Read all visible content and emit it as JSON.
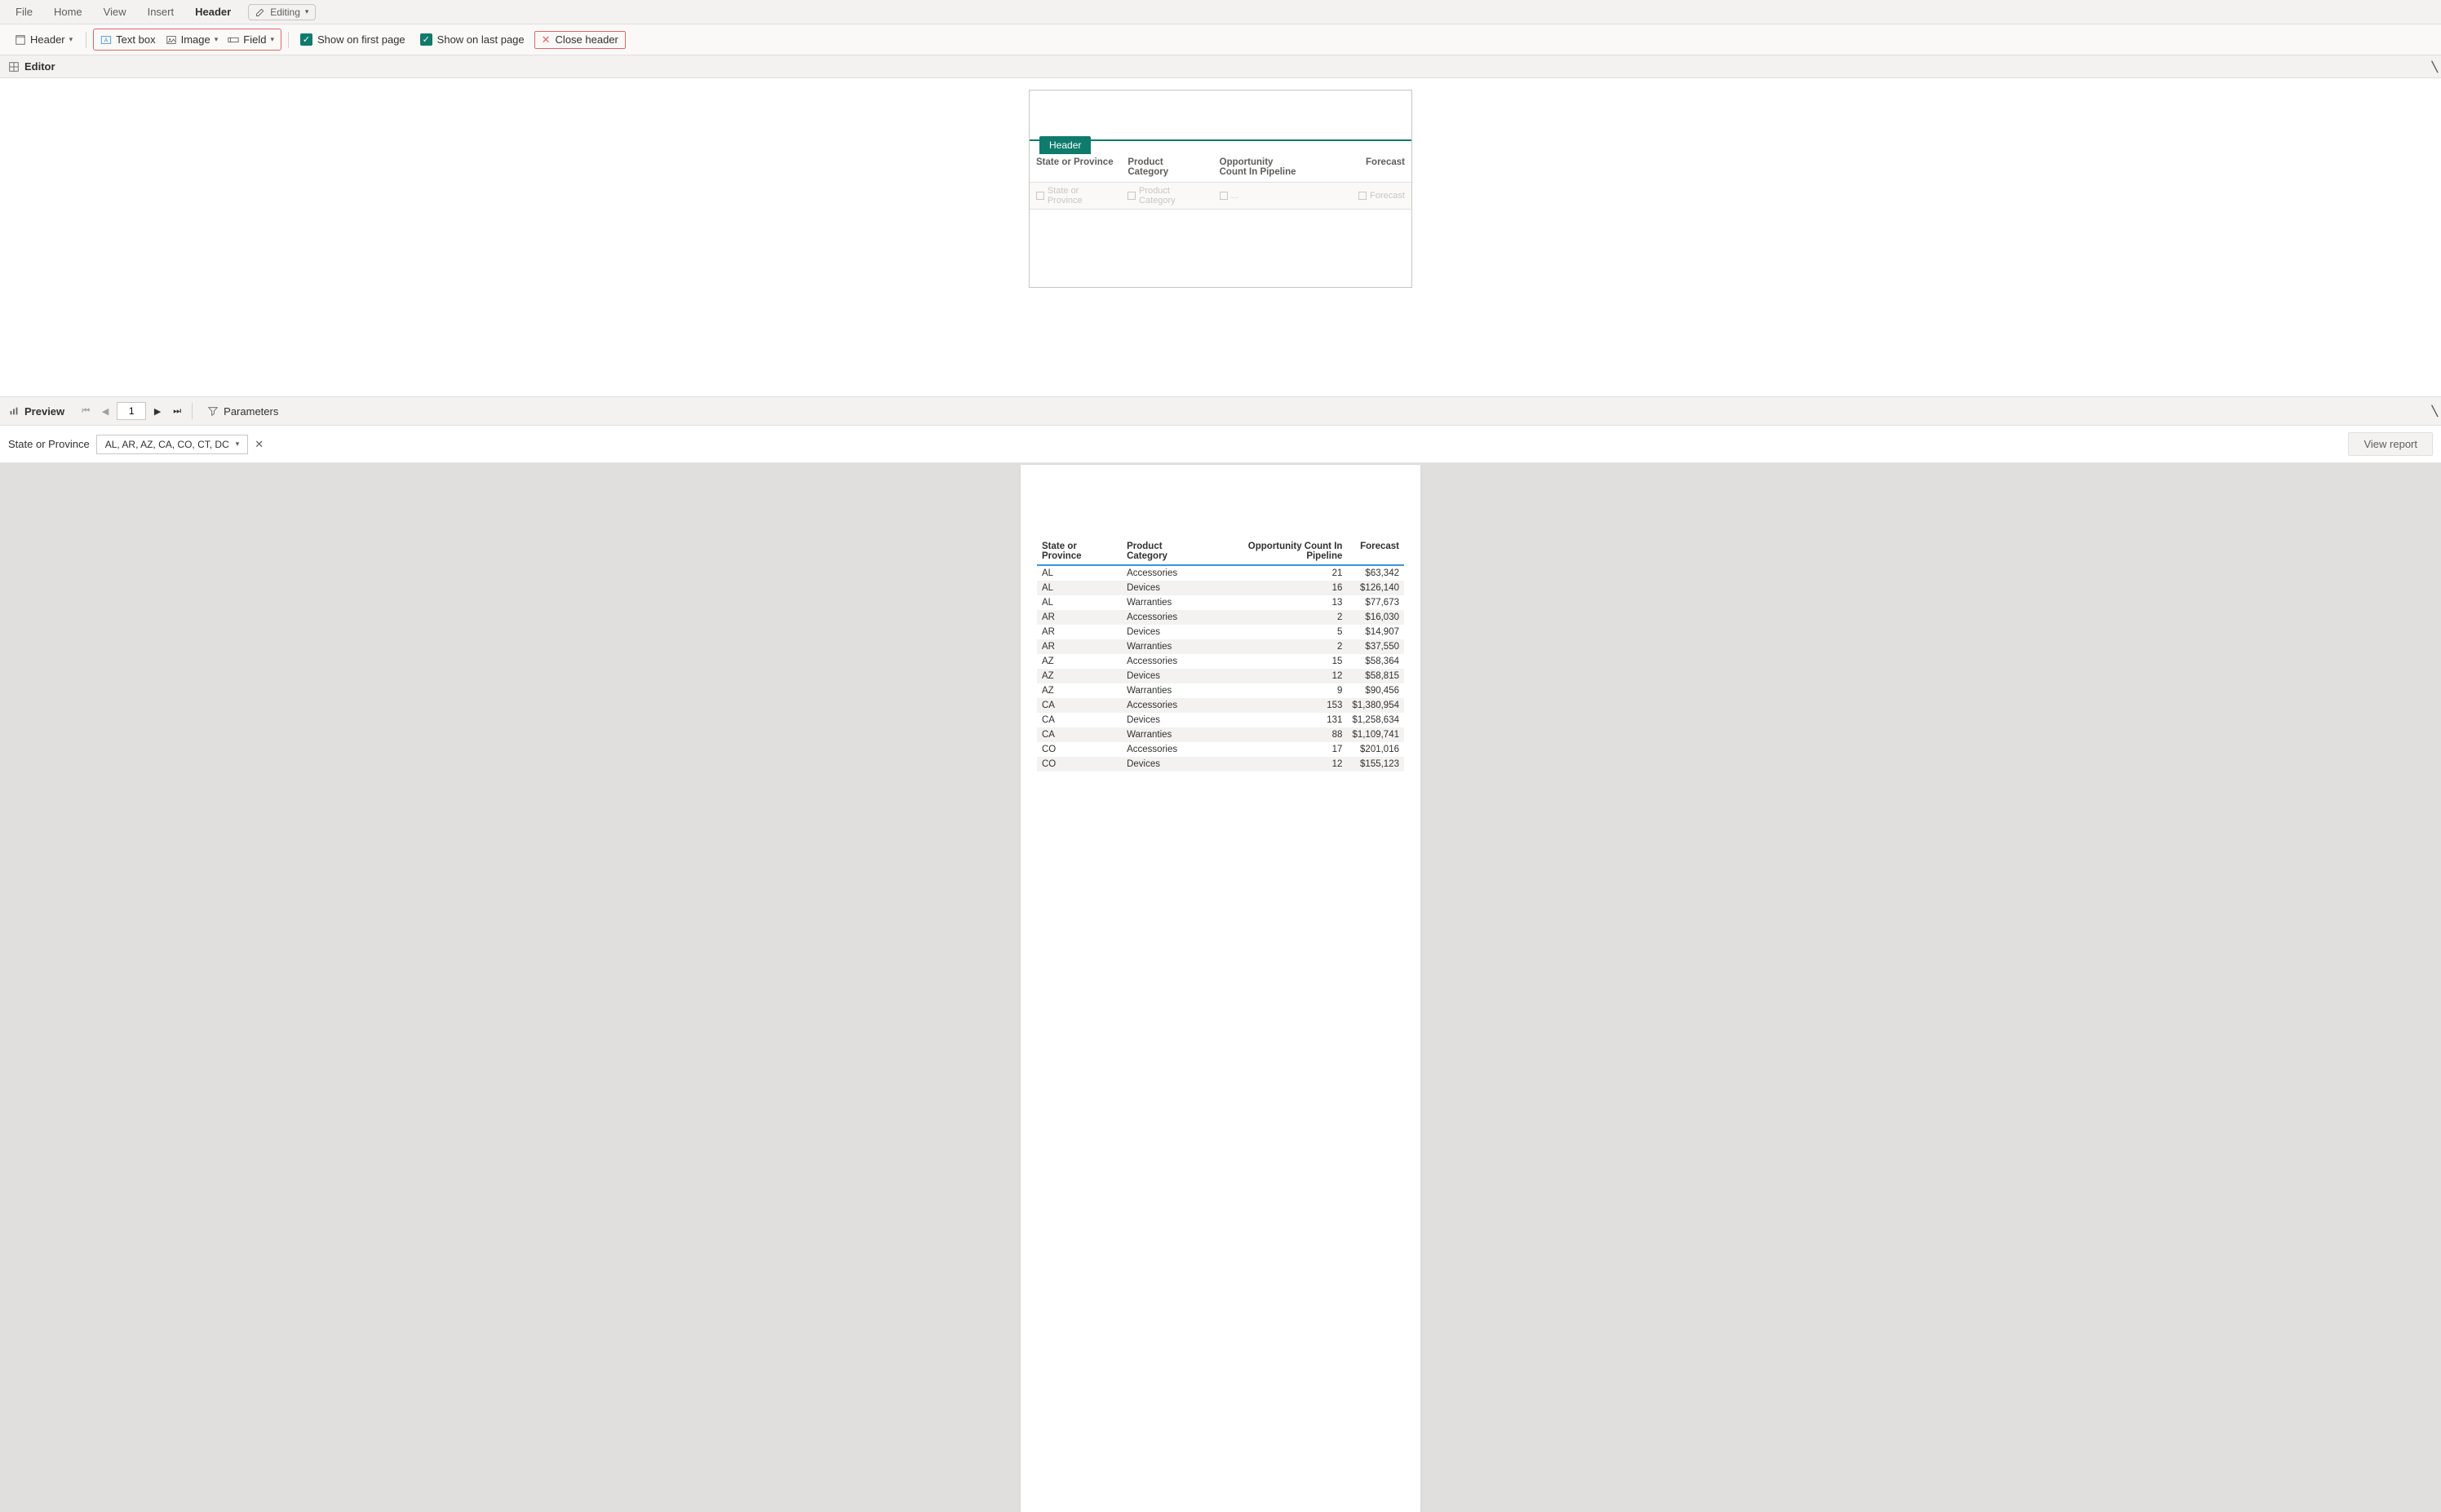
{
  "ribbon": {
    "tabs": [
      "File",
      "Home",
      "View",
      "Insert",
      "Header"
    ],
    "active_index": 4,
    "editing_label": "Editing"
  },
  "toolbar": {
    "header_btn": "Header",
    "textbox_btn": "Text box",
    "image_btn": "Image",
    "field_btn": "Field",
    "show_first_label": "Show on first page",
    "show_last_label": "Show on last page",
    "close_header_label": "Close header"
  },
  "editor_bar": {
    "label": "Editor"
  },
  "design": {
    "header_tag": "Header",
    "columns": [
      "State or Province",
      "Product Category",
      "Opportunity Count In Pipeline",
      "Forecast"
    ],
    "ghost_labels": [
      "State or Province",
      "Product Category",
      "...",
      "Forecast"
    ]
  },
  "preview_bar": {
    "label": "Preview",
    "page_value": "1",
    "parameters_label": "Parameters"
  },
  "filter": {
    "label": "State or Province",
    "value": "AL, AR, AZ, CA, CO, CT, DC",
    "view_report_label": "View report"
  },
  "report": {
    "columns": [
      "State or Province",
      "Product Category",
      "Opportunity Count In Pipeline",
      "Forecast"
    ],
    "rows": [
      {
        "state": "AL",
        "cat": "Accessories",
        "count": "21",
        "forecast": "$63,342"
      },
      {
        "state": "AL",
        "cat": "Devices",
        "count": "16",
        "forecast": "$126,140"
      },
      {
        "state": "AL",
        "cat": "Warranties",
        "count": "13",
        "forecast": "$77,673"
      },
      {
        "state": "AR",
        "cat": "Accessories",
        "count": "2",
        "forecast": "$16,030"
      },
      {
        "state": "AR",
        "cat": "Devices",
        "count": "5",
        "forecast": "$14,907"
      },
      {
        "state": "AR",
        "cat": "Warranties",
        "count": "2",
        "forecast": "$37,550"
      },
      {
        "state": "AZ",
        "cat": "Accessories",
        "count": "15",
        "forecast": "$58,364"
      },
      {
        "state": "AZ",
        "cat": "Devices",
        "count": "12",
        "forecast": "$58,815"
      },
      {
        "state": "AZ",
        "cat": "Warranties",
        "count": "9",
        "forecast": "$90,456"
      },
      {
        "state": "CA",
        "cat": "Accessories",
        "count": "153",
        "forecast": "$1,380,954"
      },
      {
        "state": "CA",
        "cat": "Devices",
        "count": "131",
        "forecast": "$1,258,634"
      },
      {
        "state": "CA",
        "cat": "Warranties",
        "count": "88",
        "forecast": "$1,109,741"
      },
      {
        "state": "CO",
        "cat": "Accessories",
        "count": "17",
        "forecast": "$201,016"
      },
      {
        "state": "CO",
        "cat": "Devices",
        "count": "12",
        "forecast": "$155,123"
      }
    ]
  }
}
